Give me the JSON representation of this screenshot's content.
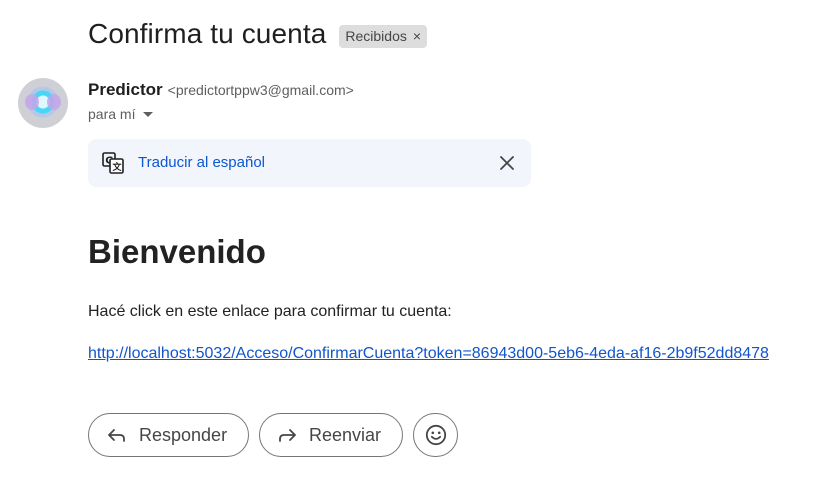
{
  "email": {
    "subject": "Confirma tu cuenta",
    "label": "Recibidos",
    "label_remove": "×",
    "sender_name": "Predictor",
    "sender_email": "<predictortppw3@gmail.com>",
    "recipient": "para mí"
  },
  "translate": {
    "link_text": "Traducir al español"
  },
  "body": {
    "heading": "Bienvenido",
    "text": "Hacé click en este enlace para confirmar tu cuenta:",
    "link": "http://localhost:5032/Acceso/ConfirmarCuenta?token=86943d00-5eb6-4eda-af16-2b9f52dd8478"
  },
  "actions": {
    "reply_label": "Responder",
    "forward_label": "Reenviar"
  },
  "colors": {
    "link_blue": "#1155cc",
    "translate_blue": "#0b57d0",
    "translate_bg": "#f2f6fc",
    "chip_bg": "#dddddd"
  },
  "icons": {
    "translate": "translate-icon",
    "close": "close-icon",
    "caret": "chevron-down-icon",
    "reply": "reply-icon",
    "forward": "forward-icon",
    "emoji": "emoji-icon"
  }
}
